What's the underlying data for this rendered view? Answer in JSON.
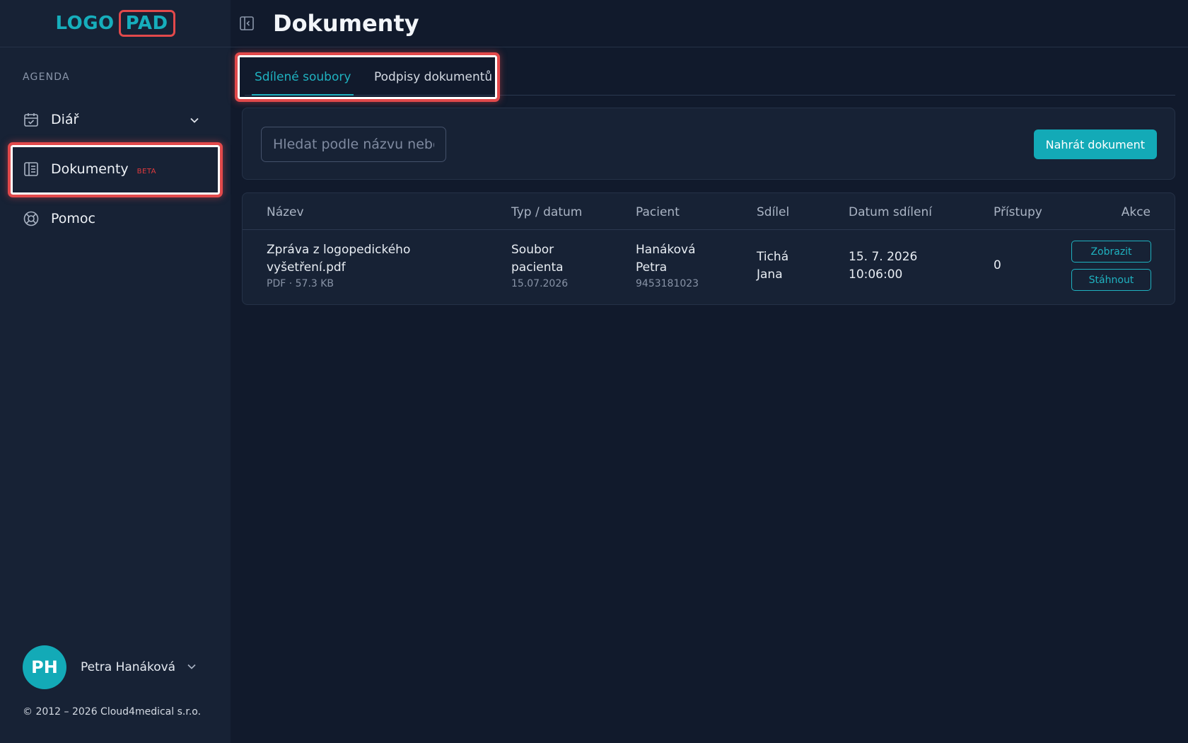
{
  "app": {
    "logo_left": "LOGO",
    "logo_right": "PAD"
  },
  "sidebar": {
    "section_label": "AGENDA",
    "items": [
      {
        "label": "Diář",
        "icon": "calendar-check-icon"
      },
      {
        "label": "Dokumenty",
        "badge": "BETA",
        "icon": "document-icon"
      },
      {
        "label": "Pomoc",
        "icon": "lifebuoy-icon"
      }
    ],
    "user": {
      "initials": "PH",
      "name": "Petra Hanáková"
    },
    "copyright": "© 2012 – 2026 Cloud4medical s.r.o."
  },
  "header": {
    "title": "Dokumenty"
  },
  "tabs": [
    {
      "label": "Sdílené soubory",
      "active": true
    },
    {
      "label": "Podpisy dokumentů",
      "active": false
    }
  ],
  "search": {
    "placeholder": "Hledat podle názvu nebo",
    "upload_label": "Nahrát dokument"
  },
  "table": {
    "columns": [
      "Název",
      "Typ / datum",
      "Pacient",
      "Sdílel",
      "Datum sdílení",
      "Přístupy",
      "Akce"
    ],
    "rows": [
      {
        "name_line1": "Zpráva z logopedického",
        "name_line2": "vyšetření.pdf",
        "name_meta": "PDF · 57.3 KB",
        "type_line1": "Soubor",
        "type_line2": "pacienta",
        "type_date": "15.07.2026",
        "patient_line1": "Hanáková",
        "patient_line2": "Petra",
        "patient_id": "9453181023",
        "shared_by_line1": "Tichá",
        "shared_by_line2": "Jana",
        "shared_date_line1": "15. 7. 2026",
        "shared_date_line2": "10:06:00",
        "access_count": "0",
        "action_view": "Zobrazit",
        "action_download": "Stáhnout"
      }
    ]
  },
  "colors": {
    "accent": "#13aab7",
    "highlight": "#e2494b",
    "background": "#111a2c",
    "sidebar": "#172235"
  }
}
